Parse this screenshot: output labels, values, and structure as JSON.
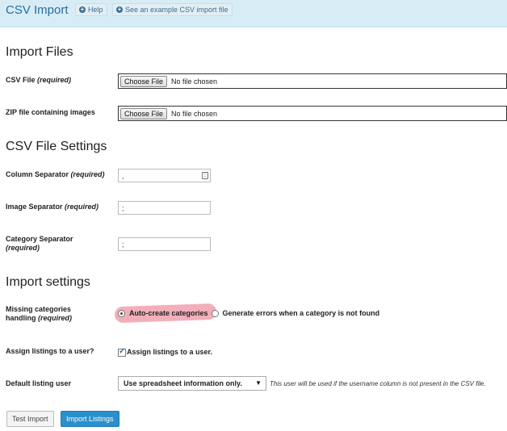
{
  "header": {
    "title": "CSV Import",
    "help_label": "Help",
    "example_label": "See an example CSV import file"
  },
  "sections": {
    "import_files": "Import Files",
    "csv_settings": "CSV File Settings",
    "import_settings": "Import settings"
  },
  "fields": {
    "csv_file": {
      "label": "CSV File",
      "req": "(required)",
      "button": "Choose File",
      "status": "No file chosen"
    },
    "zip_file": {
      "label": "ZIP file containing images",
      "button": "Choose File",
      "status": "No file chosen"
    },
    "column_sep": {
      "label": "Column Separator",
      "req": "(required)",
      "value": ","
    },
    "image_sep": {
      "label": "Image Separator",
      "req": "(required)",
      "value": ";"
    },
    "category_sep": {
      "label": "Category Separator",
      "req": "(required)",
      "value": ";"
    },
    "missing_categories": {
      "label": "Missing categories handling",
      "req": "(required)",
      "options": [
        "Auto-create categories",
        "Generate errors when a category is not found"
      ],
      "selected": "Auto-create categories"
    },
    "assign_listings": {
      "label": "Assign listings to a user?",
      "checkbox_label": "Assign listings to a user.",
      "checked": true
    },
    "default_user": {
      "label": "Default listing user",
      "selected": "Use spreadsheet information only.",
      "hint": "This user will be used if the username column is not present in the CSV file."
    }
  },
  "buttons": {
    "test": "Test Import",
    "import": "Import Listings"
  },
  "colors": {
    "topbar": "#d8ecf5",
    "title": "#2271a4",
    "primary_button": "#2a8fcb",
    "highlight": "#e86e80"
  }
}
